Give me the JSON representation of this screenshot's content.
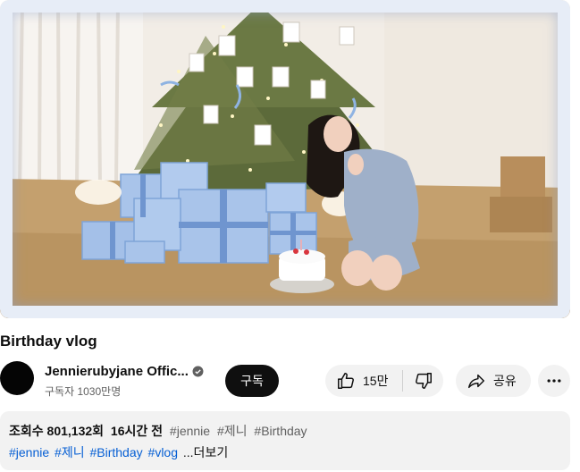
{
  "video": {
    "title": "Birthday vlog"
  },
  "channel": {
    "name": "Jennierubyjane Offic...",
    "subscribers": "구독자 1030만명",
    "subscribe_label": "구독"
  },
  "actions": {
    "like_count": "15만",
    "share_label": "공유"
  },
  "description": {
    "views": "조회수 801,132회",
    "time": "16시간 전",
    "meta_tags": [
      "#jennie",
      "#제니",
      "#Birthday"
    ],
    "hashtags": [
      "#jennie",
      "#제니",
      "#Birthday",
      "#vlog"
    ],
    "more_label": "...더보기"
  },
  "colors": {
    "subscribe_bg": "#0f0f0f",
    "pill_bg": "#f2f2f2",
    "hashtag": "#065fd4",
    "gift_blue": "#a9c4ea"
  },
  "icons": [
    "verified-icon",
    "thumbs-up-icon",
    "thumbs-down-icon",
    "share-icon",
    "more-horizontal-icon"
  ]
}
